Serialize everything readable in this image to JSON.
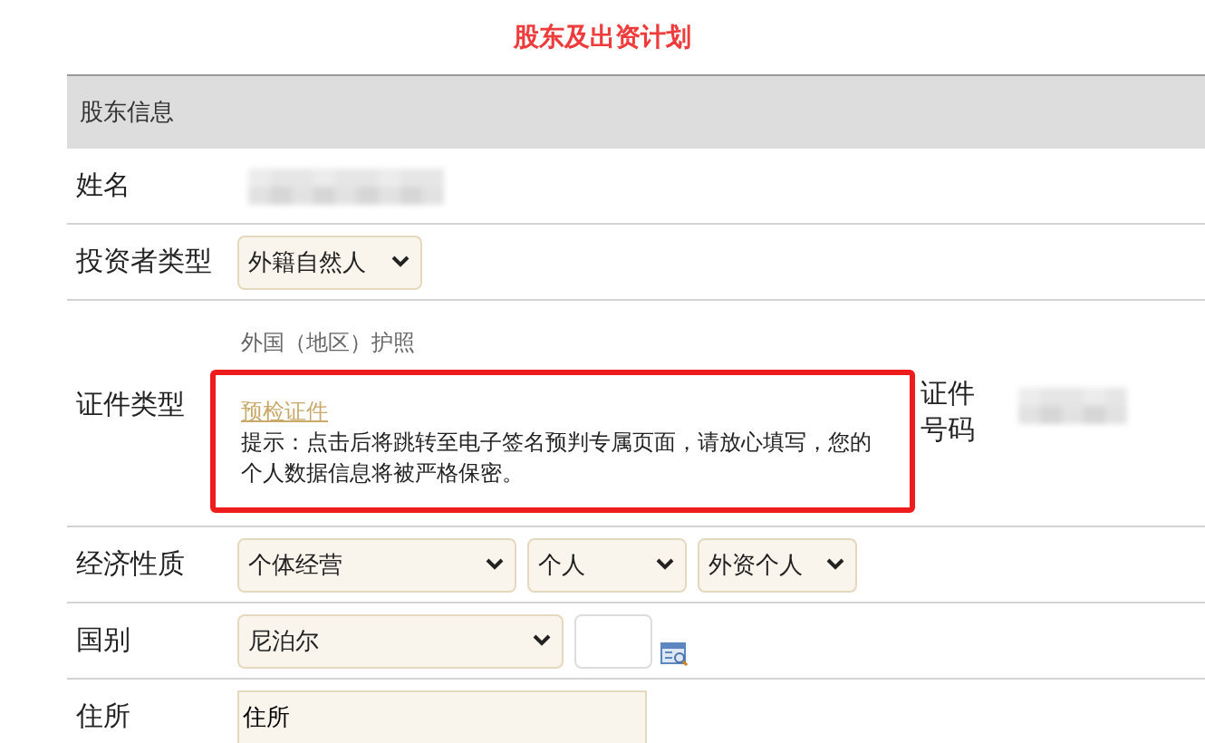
{
  "title": "股东及出资计划",
  "section": {
    "title": "股东信息"
  },
  "rows": [
    {
      "kind": "redacted",
      "label": "姓名"
    },
    {
      "kind": "selects",
      "label": "投资者类型",
      "selects": [
        {
          "value": "外籍自然人"
        }
      ]
    },
    {
      "kind": "certificate",
      "label": "证件类型",
      "certificate_name": "外国（地区）护照",
      "link": "预检证件",
      "hint": "提示：点击后将跳转至电子签名预判专属页面，请放心填写，您的个人数据信息将被严格保密。",
      "side_label": "证件号码"
    },
    {
      "kind": "selects",
      "label": "经济性质",
      "selects": [
        {
          "value": "个体经营"
        },
        {
          "value": "个人"
        },
        {
          "value": "外资个人"
        }
      ]
    },
    {
      "kind": "country",
      "label": "国别",
      "selects": [
        {
          "value": "尼泊尔"
        }
      ]
    },
    {
      "kind": "text",
      "label": "住所",
      "value": "住所"
    }
  ]
}
